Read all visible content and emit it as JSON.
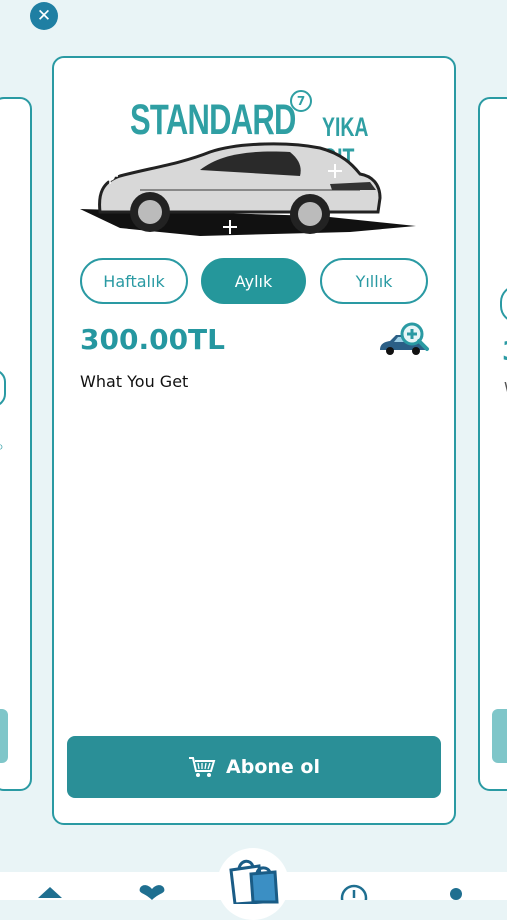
{
  "brand": {
    "name": "STANDARD",
    "suffix": "YIKA GIT",
    "badge": "7"
  },
  "plan": {
    "tabs": [
      {
        "label": "Haftalık",
        "active": false
      },
      {
        "label": "Aylık",
        "active": true
      },
      {
        "label": "Yıllık",
        "active": false
      }
    ],
    "price": "300.00TL",
    "what_you_get": "What You Get",
    "subscribe_label": "Abone ol"
  },
  "side_card_right": {
    "price_fragment": "3",
    "text_fragment": "W"
  },
  "colors": {
    "accent": "#2a9aa3",
    "button": "#2a8f97",
    "background": "#e9f4f6"
  },
  "icons": [
    "close-icon",
    "car-logo",
    "car-zoom-icon",
    "cart-icon",
    "home-icon",
    "heart-icon",
    "shopping-bags-icon",
    "clock-icon",
    "profile-icon"
  ]
}
